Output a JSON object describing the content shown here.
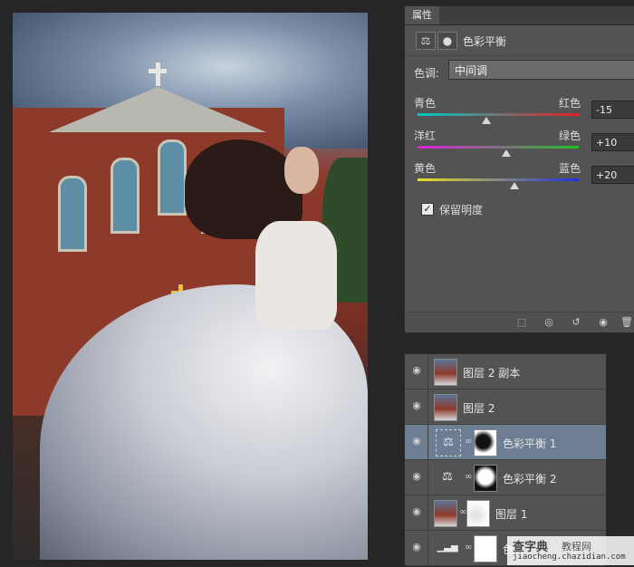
{
  "properties_panel": {
    "tab_label": "属性",
    "adjustment_icon": "balance-scale-icon",
    "mask_icon": "mask-icon",
    "title": "色彩平衡",
    "tone_label": "色调:",
    "tone_value": "中间调",
    "sliders": [
      {
        "left": "青色",
        "right": "红色",
        "value": "-15",
        "level": -15,
        "left_color": "#00c8c8",
        "right_color": "#e02020"
      },
      {
        "left": "洋红",
        "right": "绿色",
        "value": "+10",
        "level": 10,
        "left_color": "#e020e0",
        "right_color": "#20c020"
      },
      {
        "left": "黄色",
        "right": "蓝色",
        "value": "+20",
        "level": 20,
        "left_color": "#e8e020",
        "right_color": "#2030e0"
      }
    ],
    "preserve_luminosity_label": "保留明度",
    "preserve_luminosity_checked": true,
    "footer_icons": [
      "clip-to-layer-icon",
      "view-previous-icon",
      "reset-icon",
      "visibility-icon",
      "trash-icon"
    ]
  },
  "layers_panel": {
    "layers": [
      {
        "name": "图层 2 副本",
        "type": "image",
        "selected": false
      },
      {
        "name": "图层 2",
        "type": "image",
        "selected": false
      },
      {
        "name": "色彩平衡 1",
        "type": "adjustment",
        "mask": "dark",
        "selected": true
      },
      {
        "name": "色彩平衡 2",
        "type": "adjustment",
        "mask": "white",
        "selected": false
      },
      {
        "name": "图层 1",
        "type": "image",
        "mask": "light",
        "selected": false
      },
      {
        "name": "色阶",
        "type": "adjustment",
        "mask": "light",
        "selected": false
      }
    ]
  },
  "watermark": {
    "line1": "查字典",
    "line2": "教程网",
    "line3": "jiaocheng.chazidian.com"
  },
  "colors": {
    "selected_layer": "#6d7d94",
    "panel_bg": "#535353"
  }
}
